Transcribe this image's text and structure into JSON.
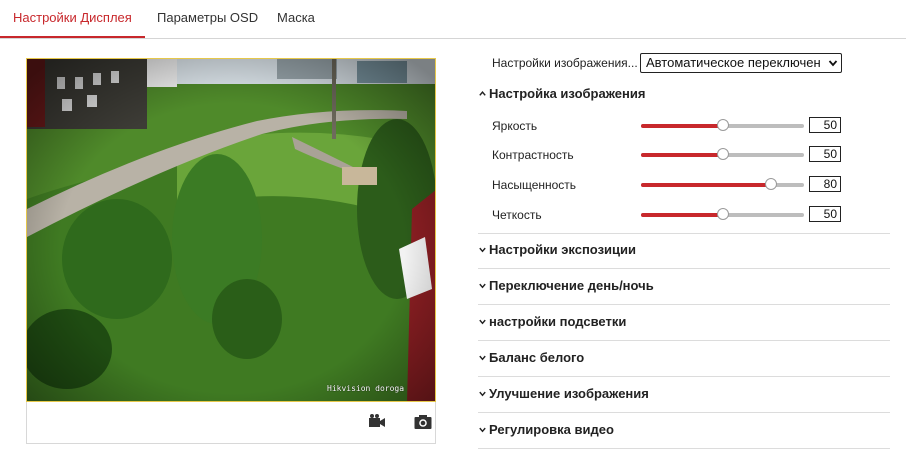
{
  "tabs": [
    {
      "label": "Настройки Дисплея",
      "active": true
    },
    {
      "label": "Параметры OSD",
      "active": false
    },
    {
      "label": "Маска",
      "active": false
    }
  ],
  "preview": {
    "osd_text": "Hikvision doroga"
  },
  "toolbar": {
    "record_icon": "video-record-icon",
    "capture_icon": "camera-icon"
  },
  "image_settings": {
    "label": "Настройки изображения...",
    "selected": "Автоматическое переключен"
  },
  "adjust_section": {
    "title": "Настройка изображения",
    "sliders": [
      {
        "label": "Яркость",
        "value": 50
      },
      {
        "label": "Контрастность",
        "value": 50
      },
      {
        "label": "Насыщенность",
        "value": 80
      },
      {
        "label": "Четкость",
        "value": 50
      }
    ]
  },
  "sections": [
    {
      "title": "Настройки экспозиции"
    },
    {
      "title": "Переключение день/ночь"
    },
    {
      "title": "настройки подсветки"
    },
    {
      "title": "Баланс белого"
    },
    {
      "title": "Улучшение изображения"
    },
    {
      "title": "Регулировка видео"
    }
  ],
  "colors": {
    "accent": "#c8282c",
    "track": "#bdbdbd"
  }
}
